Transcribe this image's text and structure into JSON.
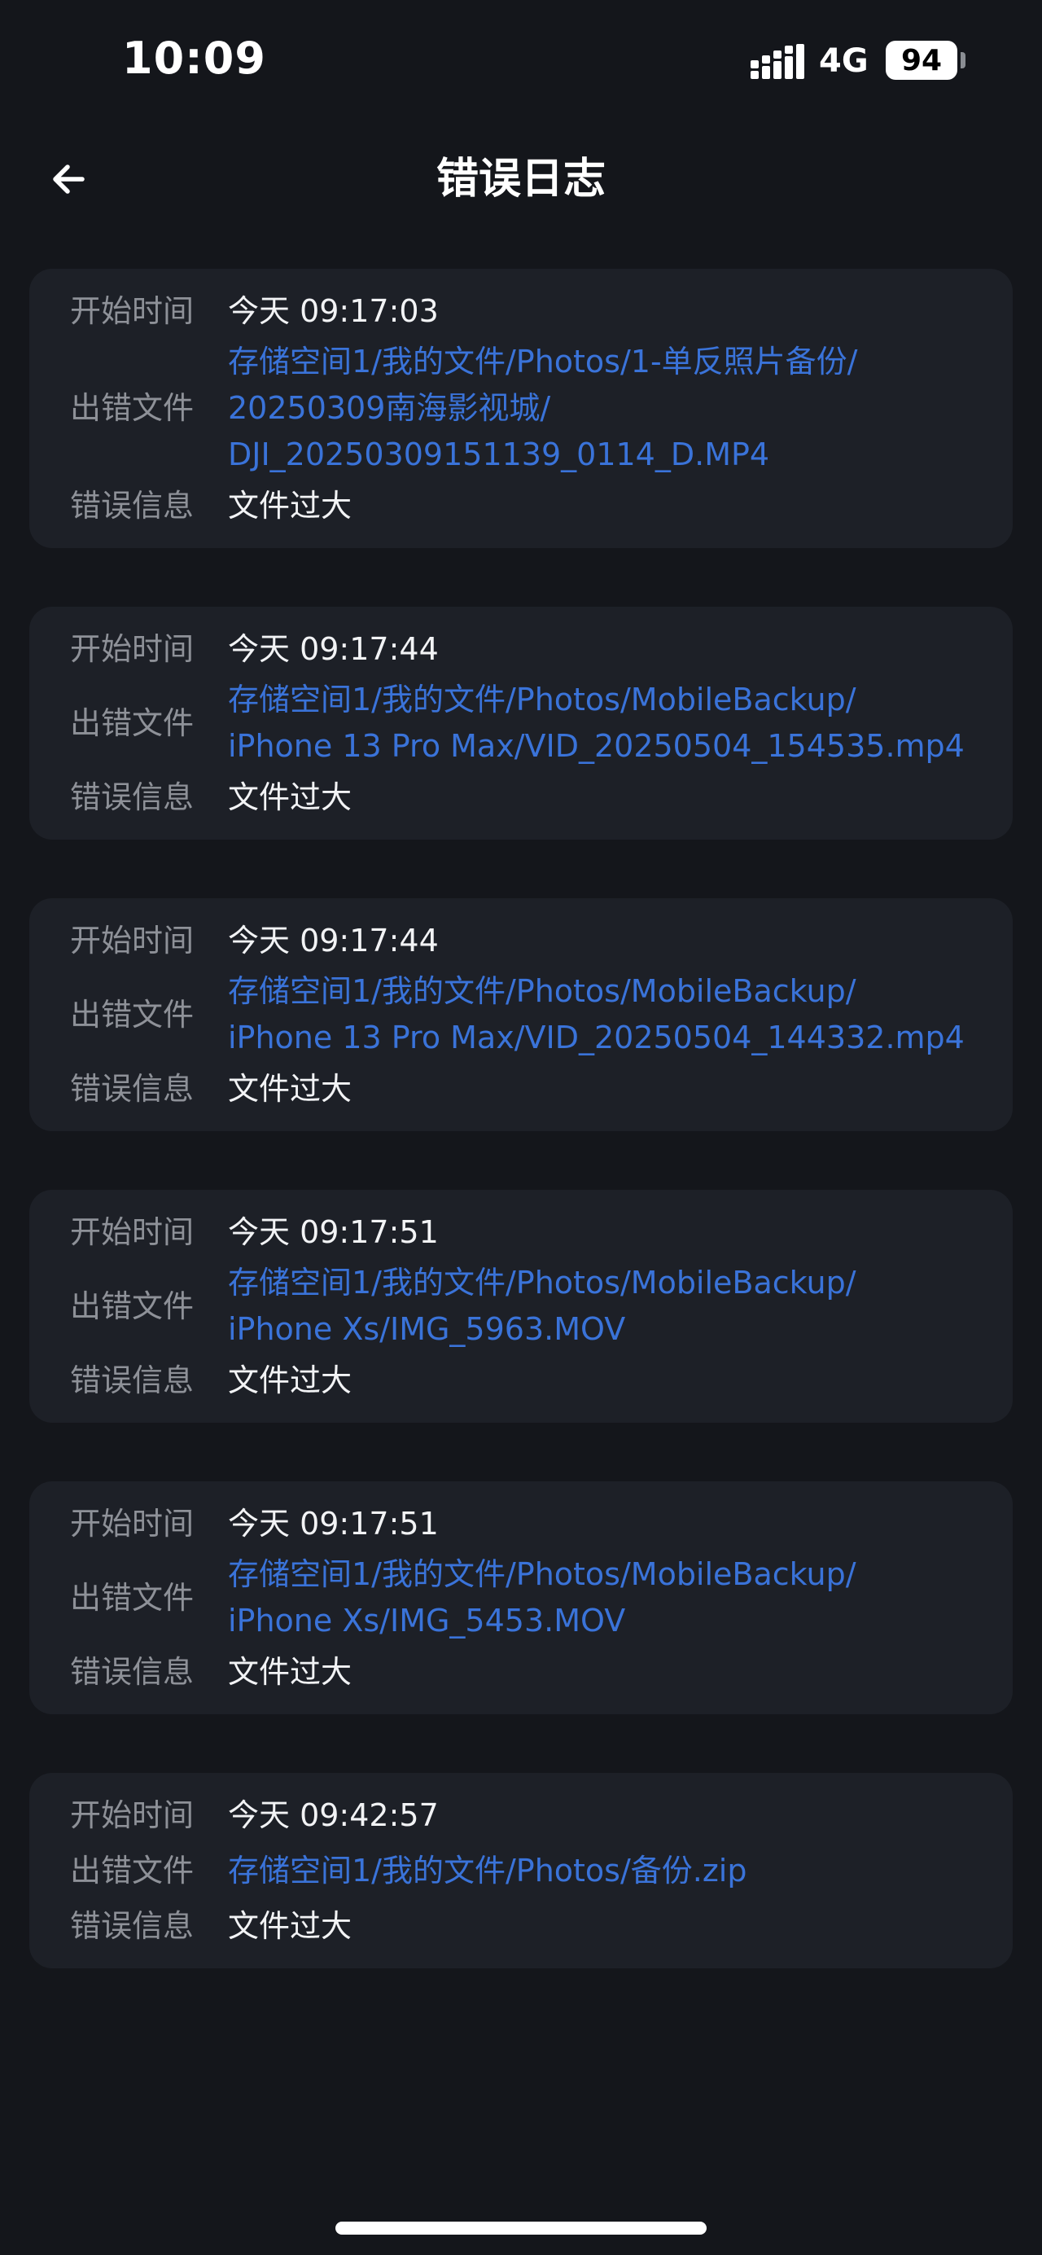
{
  "status_bar": {
    "time": "10:09",
    "network": "4G",
    "battery_level": "94",
    "icons": [
      "signal-icon",
      "battery-icon"
    ]
  },
  "nav": {
    "title": "错误日志",
    "back_icon": "arrow-left-icon"
  },
  "labels": {
    "start_time": "开始时间",
    "error_file": "出错文件",
    "error_info": "错误信息"
  },
  "logs": [
    {
      "start_time": "今天 09:17:03",
      "file_lines": [
        "存储空间1/我的文件/Photos/1-单反照片备份/",
        "20250309南海影视城/",
        "DJI_20250309151139_0114_D.MP4"
      ],
      "error": "文件过大"
    },
    {
      "start_time": "今天 09:17:44",
      "file_lines": [
        "存储空间1/我的文件/Photos/MobileBackup/",
        "iPhone 13 Pro Max/VID_20250504_154535.mp4"
      ],
      "error": "文件过大"
    },
    {
      "start_time": "今天 09:17:44",
      "file_lines": [
        "存储空间1/我的文件/Photos/MobileBackup/",
        "iPhone 13 Pro Max/VID_20250504_144332.mp4"
      ],
      "error": "文件过大"
    },
    {
      "start_time": "今天 09:17:51",
      "file_lines": [
        "存储空间1/我的文件/Photos/MobileBackup/",
        "iPhone Xs/IMG_5963.MOV"
      ],
      "error": "文件过大"
    },
    {
      "start_time": "今天 09:17:51",
      "file_lines": [
        "存储空间1/我的文件/Photos/MobileBackup/",
        "iPhone Xs/IMG_5453.MOV"
      ],
      "error": "文件过大"
    },
    {
      "start_time": "今天 09:42:57",
      "file_lines": [
        "存储空间1/我的文件/Photos/备份.zip"
      ],
      "error": "文件过大"
    }
  ],
  "colors": {
    "background": "#14161b",
    "card": "#1d2027",
    "label": "#8e9198",
    "value": "#f2f3f5",
    "link": "#3a73d9"
  }
}
